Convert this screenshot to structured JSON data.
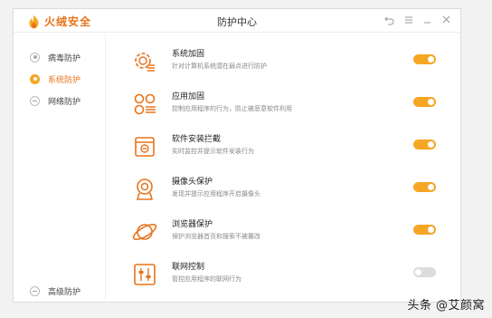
{
  "app": {
    "brand": "火绒安全",
    "title": "防护中心",
    "accent": "#f5a623",
    "brand_color": "#e8731a"
  },
  "window_controls": [
    "back-icon",
    "menu-icon",
    "minimize-icon",
    "close-icon"
  ],
  "sidebar": {
    "items": [
      {
        "label": "病毒防护",
        "icon": "virus-shield-icon",
        "active": false
      },
      {
        "label": "系统防护",
        "icon": "system-shield-icon",
        "active": true
      },
      {
        "label": "网络防护",
        "icon": "network-shield-icon",
        "active": false
      }
    ],
    "bottom": {
      "label": "高级防护",
      "icon": "advanced-shield-icon"
    }
  },
  "features": [
    {
      "title": "系统加固",
      "desc": "针对计算机系统潜在弱点进行防护",
      "icon": "gear-list-icon",
      "enabled": true
    },
    {
      "title": "应用加固",
      "desc": "控制应用程序的行为，防止被恶意软件利用",
      "icon": "app-grid-icon",
      "enabled": true
    },
    {
      "title": "软件安装拦截",
      "desc": "实时监控并提示软件安装行为",
      "icon": "install-block-icon",
      "enabled": true
    },
    {
      "title": "摄像头保护",
      "desc": "发现并提示应用程序开启摄像头",
      "icon": "camera-icon",
      "enabled": true
    },
    {
      "title": "浏览器保护",
      "desc": "保护浏览器首页和搜索不被篡改",
      "icon": "browser-planet-icon",
      "enabled": true
    },
    {
      "title": "联网控制",
      "desc": "管控应用程序的联网行为",
      "icon": "network-control-icon",
      "enabled": false
    }
  ],
  "watermark": "头条 @艾颜窝"
}
